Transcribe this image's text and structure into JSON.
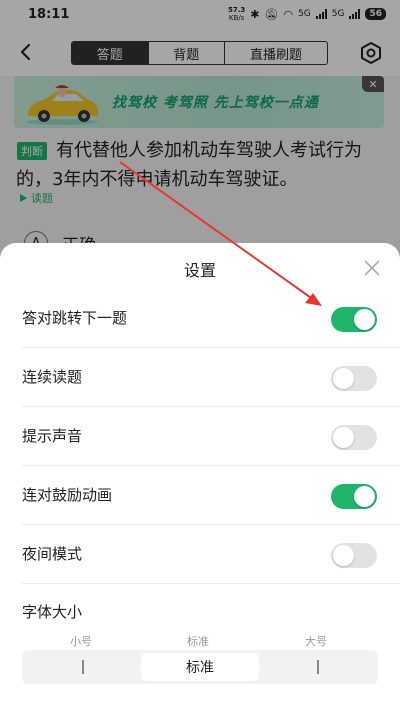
{
  "status": {
    "time": "18:11",
    "net_speed": "57.3",
    "net_unit": "KB/s",
    "signal_1": "5G",
    "signal_2": "5G",
    "battery": "56"
  },
  "nav": {
    "tabs": [
      {
        "label": "答题",
        "active": true
      },
      {
        "label": "背题",
        "active": false
      },
      {
        "label": "直播刷题",
        "active": false
      }
    ]
  },
  "banner": {
    "text": "找驾校 考驾照 先上驾校一点通",
    "close": "✕"
  },
  "question": {
    "type_badge": "判断",
    "text": "有代替他人参加机动车驾驶人考试行为的，3年内不得申请机动车驾驶证。",
    "read_label": "读题",
    "option_a_letter": "A",
    "option_a_label": "正确"
  },
  "settings": {
    "title": "设置",
    "rows": [
      {
        "label": "答对跳转下一题",
        "on": true
      },
      {
        "label": "连续读题",
        "on": false
      },
      {
        "label": "提示声音",
        "on": false
      },
      {
        "label": "连对鼓励动画",
        "on": true
      },
      {
        "label": "夜间模式",
        "on": false
      }
    ],
    "font_size_title": "字体大小",
    "font_sizes": [
      "小号",
      "标准",
      "大号"
    ],
    "selected_font_size": "标准"
  },
  "colors": {
    "accent": "#1fb56a",
    "banner_text": "#11a36a",
    "arrow": "#e53935"
  }
}
